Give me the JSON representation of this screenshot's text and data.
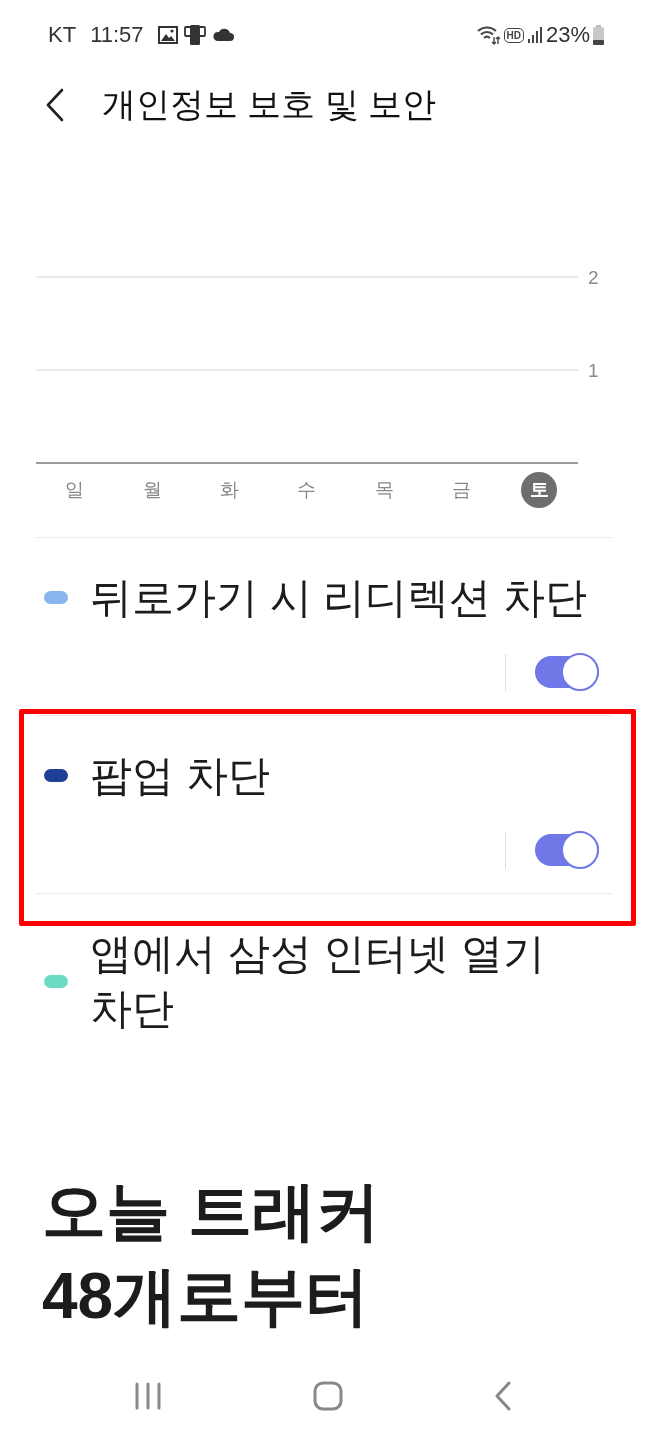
{
  "status_bar": {
    "carrier": "KT",
    "time": "11:57",
    "call_badge": "HD",
    "battery": "23%"
  },
  "app_bar": {
    "title": "개인정보 보호 및 보안"
  },
  "chart": {
    "chart_data": {
      "type": "bar",
      "categories": [
        "일",
        "월",
        "화",
        "수",
        "목",
        "금",
        "토"
      ],
      "series": [
        {
          "color": "#8ab4ec",
          "values": [
            0,
            0,
            0,
            0,
            0,
            0,
            0
          ]
        },
        {
          "color": "#1f3f94",
          "values": [
            0,
            0,
            0,
            0,
            0,
            0,
            0
          ]
        },
        {
          "color": "#6ddcc4",
          "values": [
            0,
            0,
            0,
            0,
            0,
            0,
            0
          ]
        }
      ],
      "ylim": [
        0,
        2
      ],
      "yticks": [
        1,
        2
      ]
    },
    "days": [
      {
        "selected": false
      },
      {
        "selected": false
      },
      {
        "selected": false
      },
      {
        "selected": false
      },
      {
        "selected": false
      },
      {
        "selected": false
      },
      {
        "selected": true
      }
    ]
  },
  "items": [
    {
      "kind": "toggle",
      "title": "뒤로가기 시 리디렉션 차단",
      "on": true,
      "highlighted": false
    },
    {
      "kind": "toggle",
      "title": "팝업 차단",
      "on": true,
      "highlighted": true
    },
    {
      "kind": "label",
      "title": "앱에서 삼성 인터넷 열기 차단",
      "highlighted": false
    }
  ],
  "summary": {
    "headline": "오늘 트래커 48개로부터"
  }
}
